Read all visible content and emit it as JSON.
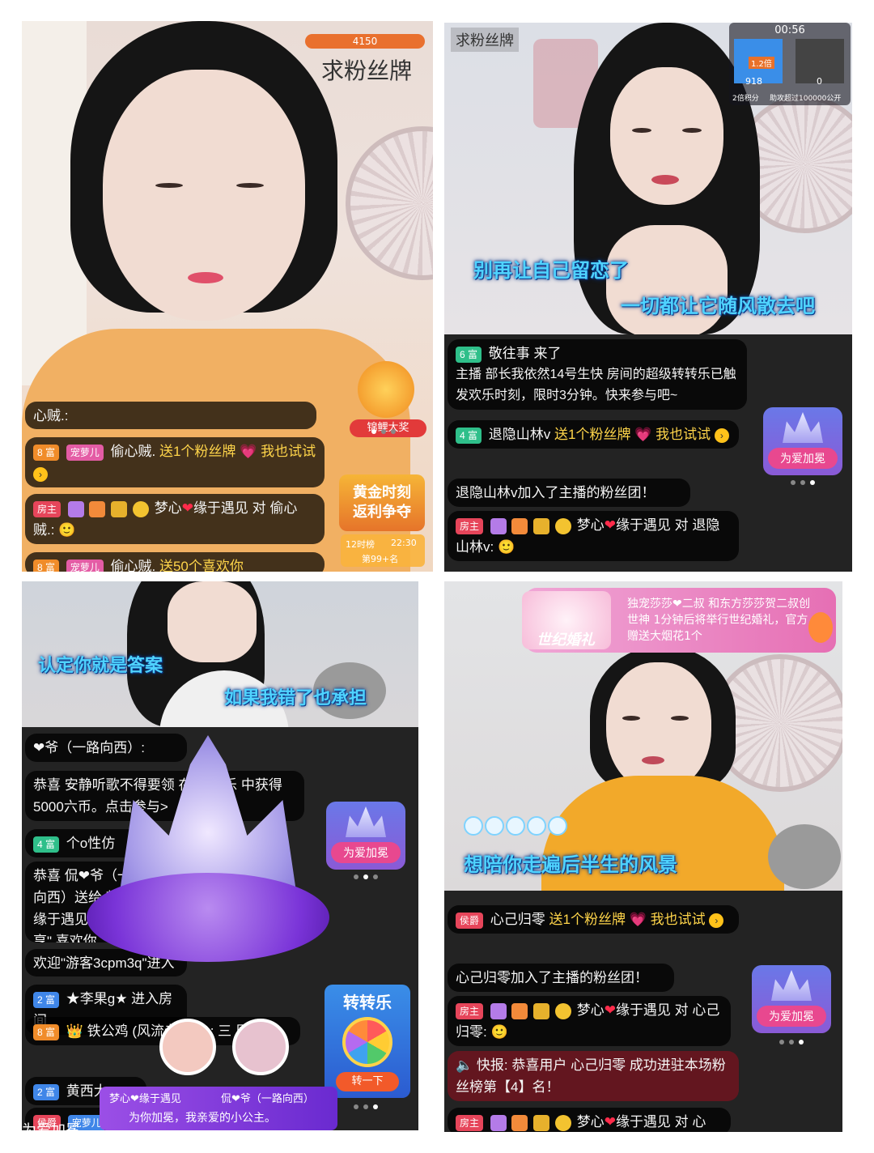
{
  "panel1": {
    "fan_count": "4150",
    "fan_badge_request": "求粉丝牌",
    "prize_label": "锦鲤大奖",
    "golden_promo": "黄金时刻\n返利争夺",
    "rank_hours": "12时榜",
    "rank_time": "22:30",
    "rank_place": "第99+名",
    "messages": [
      {
        "text": "心贼.: "
      },
      {
        "level": "8 富",
        "tag": "宠萝儿",
        "user": "偷心贼.",
        "body": "送1个粉丝牌",
        "tail": "我也试试"
      },
      {
        "level": "房主",
        "user": "梦心",
        "heart": "❤",
        "user2": "缘于遇见",
        "body": "对 偷心贼.: "
      },
      {
        "level": "8 富",
        "tag": "宠萝儿",
        "user": "偷心贼.",
        "body": "送50个喜欢你"
      }
    ]
  },
  "panel2": {
    "fan_badge_request": "求粉丝牌",
    "pk_time": "00:56",
    "pk_multiplier": "1.2倍",
    "pk_score_left": "918",
    "pk_score_right": "0",
    "pk_left_label": "2倍积分",
    "pk_right_label": "助攻超过100000公开",
    "lyric_1": "别再让自己留恋了",
    "lyric_2": "一切都让它随风散去吧",
    "messages": [
      {
        "level": "6 富",
        "user": "敬往事 来了",
        "body": "主播 部长我依然14号生快 房间的超级转转乐已触发欢乐时刻，限时3分钟。快来参与吧~"
      },
      {
        "level": "4 富",
        "user": "退隐山林v",
        "body": "送1个粉丝牌",
        "tail": "我也试试"
      },
      {
        "body": "退隐山林v加入了主播的粉丝团！"
      },
      {
        "level": "房主",
        "user": "梦心",
        "heart": "❤",
        "user2": "缘于遇见",
        "body": "对 退隐山林v: "
      }
    ],
    "crown_button": "为爱加冕"
  },
  "panel3": {
    "lyric_1": "认定你就是答案",
    "lyric_2": "如果我错了也承担",
    "messages": [
      {
        "body": "❤爷（一路向西）: "
      },
      {
        "body": "恭喜 安静听歌不得要领 在 转转乐 中获得5000六币。点击参与>"
      },
      {
        "level": "4 富",
        "body": "个o性仿"
      },
      {
        "body": "恭喜 侃❤爷（一路向西）送给 梦心❤缘于遇见 与\"5元畅享\" 喜欢你。点击参与"
      },
      {
        "body": "欢迎\"游客3cpm3q\"进入房间"
      },
      {
        "level": "2 富",
        "body": "★李果g★ 进入房间"
      },
      {
        "level": "8 富",
        "body": "铁公鸡 (风流老大爷): 三 周年"
      },
      {
        "level": "2 富",
        "body": "黄西大"
      },
      {
        "level": "侯爵",
        "tag": "宠萝儿",
        "body": "侃"
      }
    ],
    "crown_button": "为爱加冕",
    "spin_label": "转转乐",
    "spin_button": "转一下",
    "duo_left": "梦心❤缘于遇见",
    "duo_right": "侃❤爷（一路向西）",
    "dedication": "为你加冕，我亲爱的小公主。",
    "footer_label": "为爱加冕"
  },
  "panel4": {
    "wedding_label": "世纪婚礼",
    "wedding_notice": "独宠莎莎❤二叔 和东方莎莎贺二叔创世神 1分钟后将举行世纪婚礼，官方赠送大烟花1个",
    "lyric": "想陪你走遍后半生的风景",
    "messages": [
      {
        "level": "侯爵",
        "user": "心己归零",
        "body": "送1个粉丝牌",
        "tail": "我也试试"
      },
      {
        "body": "心己归零加入了主播的粉丝团！"
      },
      {
        "level": "房主",
        "user": "梦心",
        "heart": "❤",
        "user2": "缘于遇见",
        "body": "对 心己归零: "
      },
      {
        "body": "快报: 恭喜用户 心己归零 成功进驻本场粉丝榜第【4】名！"
      },
      {
        "level": "房主",
        "user": "梦心",
        "heart": "❤",
        "user2": "缘于遇见",
        "body": "对 心"
      }
    ],
    "crown_button": "为爱加冕"
  }
}
